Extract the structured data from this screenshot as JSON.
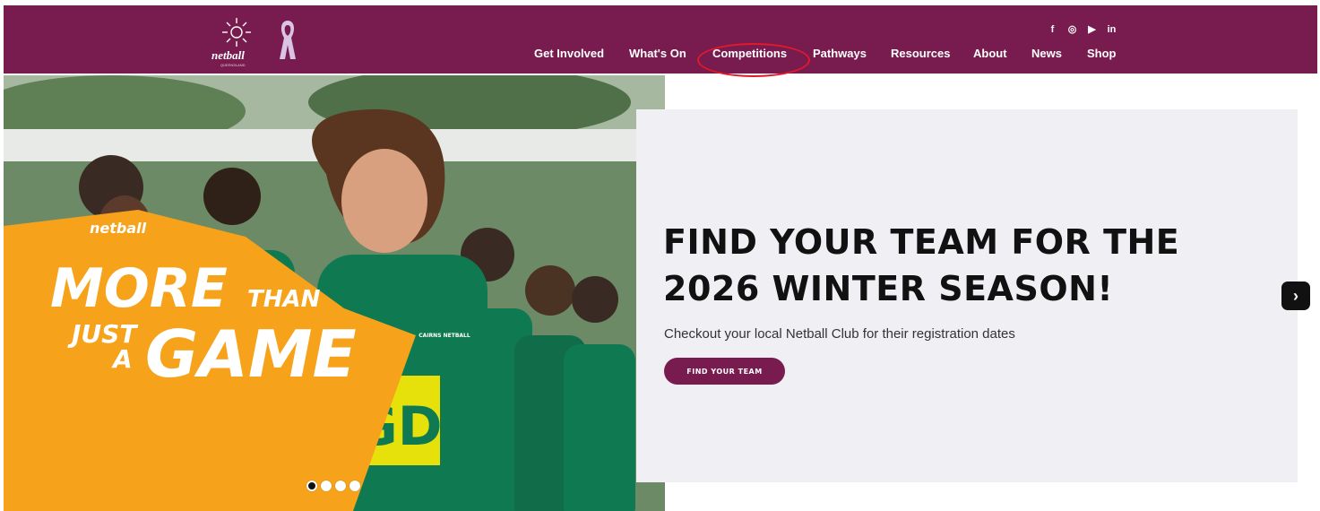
{
  "header": {
    "brand": {
      "logo_text": "netball",
      "logo_subtext": "QUEENSLAND"
    },
    "socials": [
      {
        "icon": "facebook-icon",
        "glyph": "f"
      },
      {
        "icon": "instagram-icon",
        "glyph": "◎"
      },
      {
        "icon": "youtube-icon",
        "glyph": "▶"
      },
      {
        "icon": "linkedin-icon",
        "glyph": "in"
      }
    ],
    "nav": [
      "Get Involved",
      "What's On",
      "Competitions",
      "Pathways",
      "Resources",
      "About",
      "News",
      "Shop"
    ],
    "highlighted_nav": "Competitions"
  },
  "hero": {
    "banner": {
      "brand": "netball",
      "line1": "MORE",
      "line2": "THAN",
      "line3": "JUST",
      "line4": "A",
      "line5": "GAME",
      "bib": "GD",
      "jersey_text": "CAIRNS NETBALL"
    },
    "title_line1": "FIND YOUR TEAM FOR THE",
    "title_line2": "2026 WINTER SEASON!",
    "subtitle": "Checkout your local Netball Club for their registration dates",
    "cta_label": "FIND YOUR TEAM",
    "next_glyph": "›",
    "slides_count": 4,
    "active_slide": 1
  },
  "colors": {
    "brand": "#781b4e",
    "highlight_ring": "#e3182a",
    "card_bg": "#f0eff4",
    "banner_orange": "#f6a21a",
    "jersey_green": "#0f7a52",
    "bib_yellow": "#e6e10a"
  }
}
